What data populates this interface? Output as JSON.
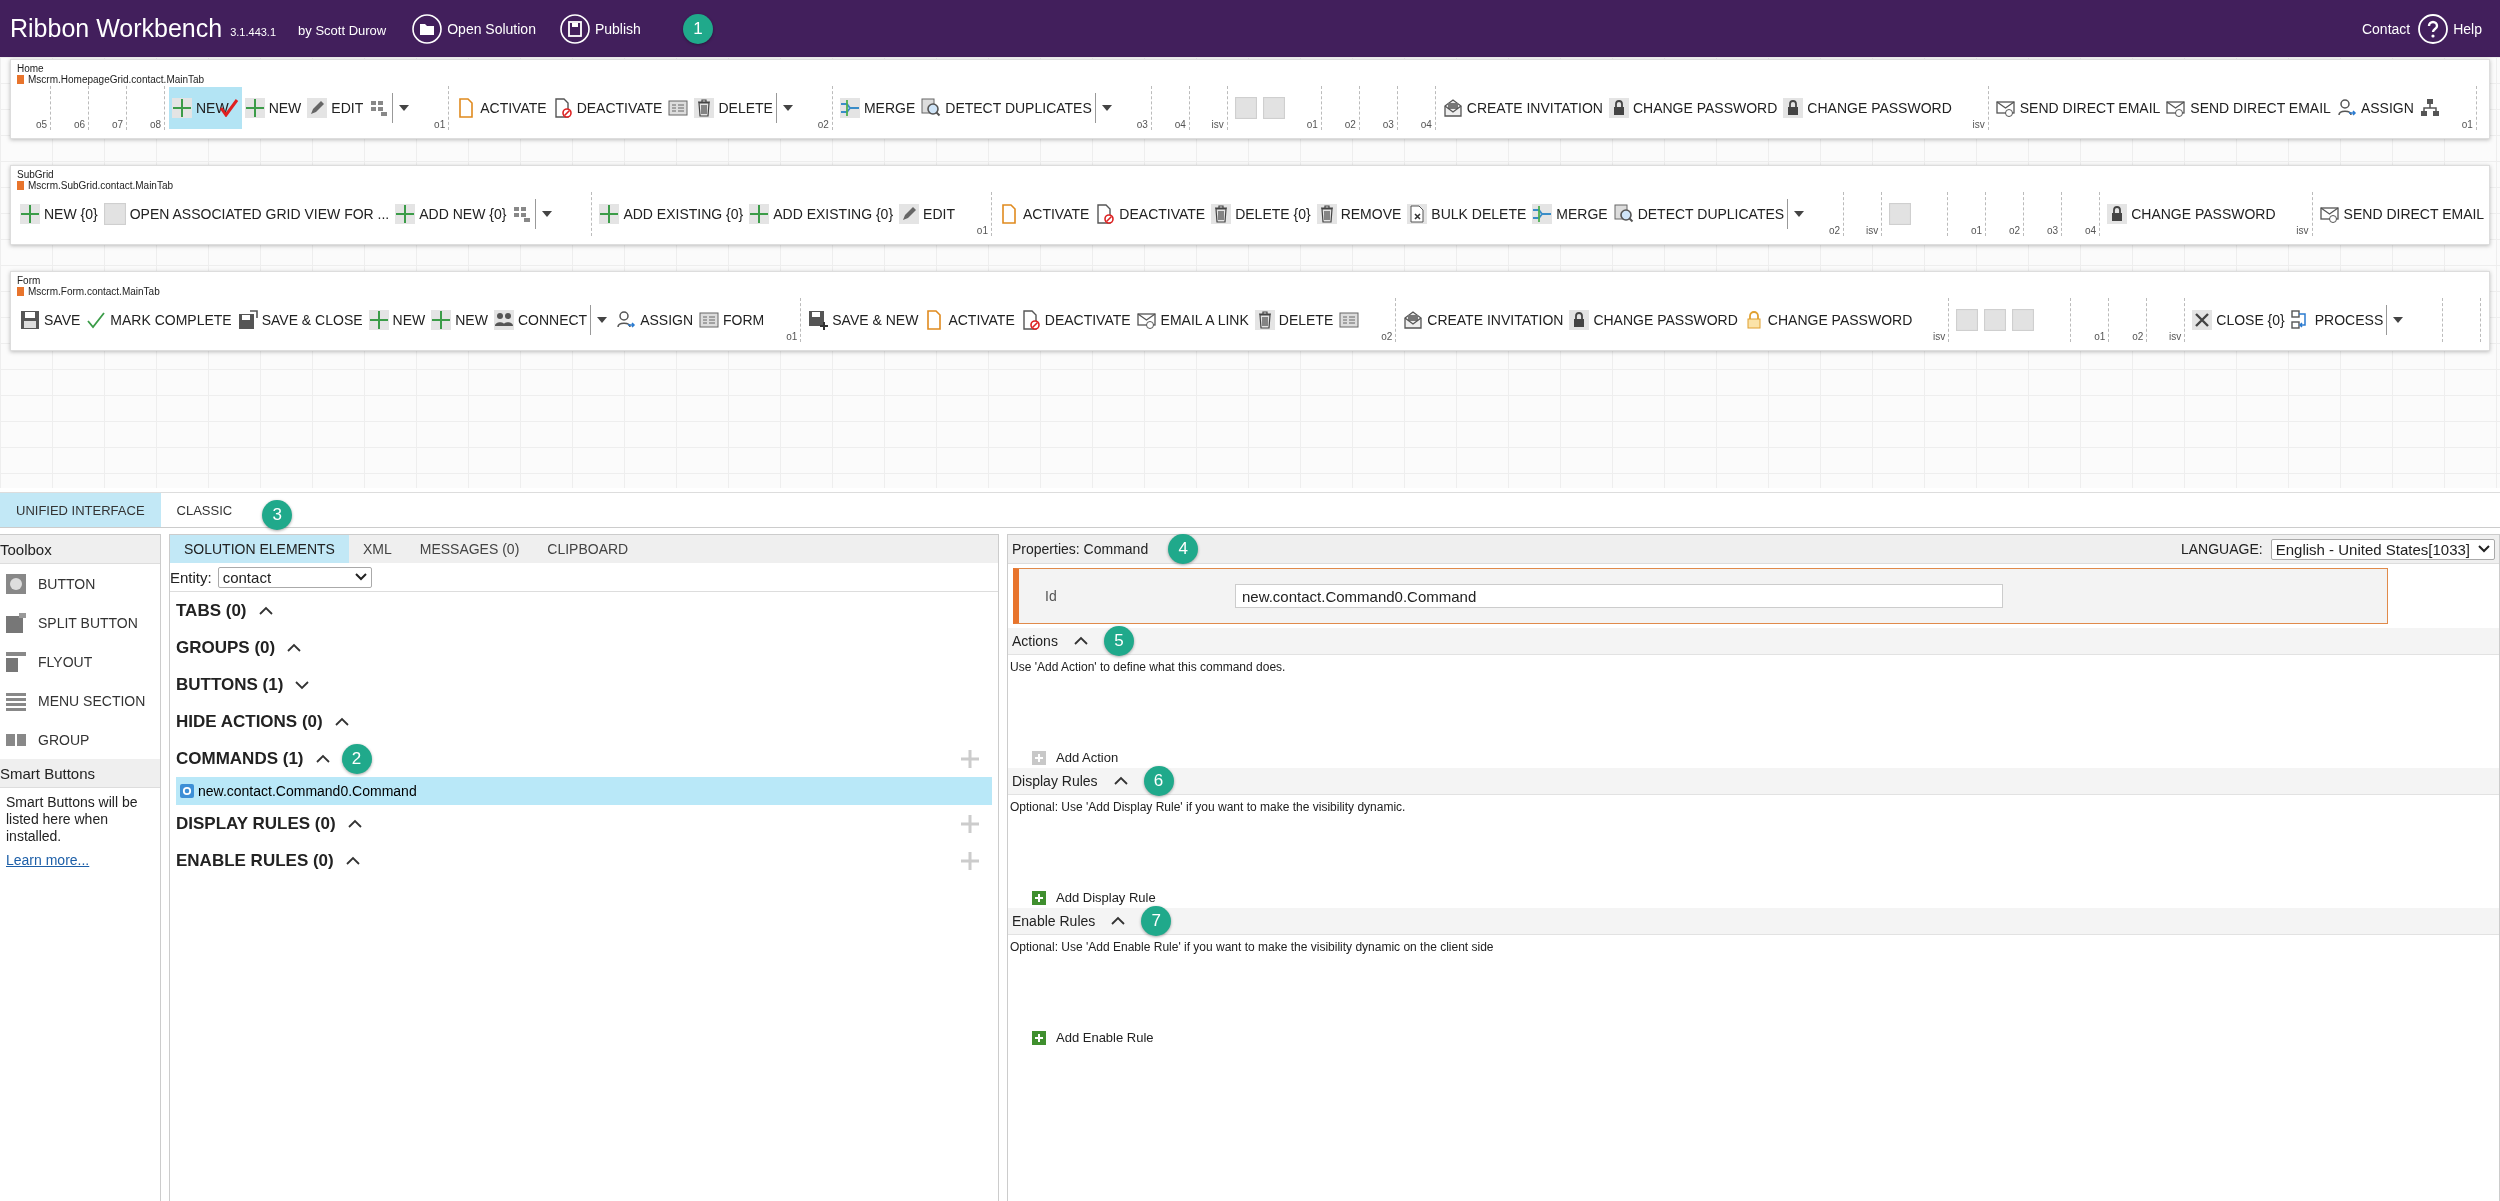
{
  "app": {
    "title": "Ribbon Workbench",
    "version": "3.1.443.1",
    "author": "by Scott Durow",
    "badge": "1"
  },
  "toolbar": [
    {
      "kind": "folder",
      "label": "Open Solution"
    },
    {
      "kind": "save",
      "label": "Publish"
    }
  ],
  "top_links": [
    {
      "kind": "text",
      "label": "Contact"
    },
    {
      "kind": "help",
      "label": "Help"
    }
  ],
  "ribbons": [
    {
      "name": "Home",
      "tab_id": "Mscrm.HomepageGrid.contact.MainTab",
      "items": [
        {
          "kind": "marker",
          "label": "o5"
        },
        {
          "kind": "marker",
          "label": "o6"
        },
        {
          "kind": "marker",
          "label": "o7"
        },
        {
          "kind": "marker",
          "label": "o8"
        },
        {
          "kind": "add",
          "label": "NEW",
          "selected": true
        },
        {
          "kind": "add",
          "label": "NEW",
          "selected": false
        },
        {
          "kind": "edit",
          "label": "EDIT",
          "selected": false
        },
        {
          "kind": "grid",
          "selected": false
        },
        {
          "kind": "dropdown",
          "selected": false
        },
        {
          "kind": "marker",
          "label": "o1"
        },
        {
          "kind": "doc",
          "label": "ACTIVATE",
          "selected": false
        },
        {
          "kind": "docx",
          "label": "DEACTIVATE",
          "selected": false
        },
        {
          "kind": "form",
          "selected": false
        },
        {
          "kind": "trash",
          "label": "DELETE",
          "selected": false
        },
        {
          "kind": "dropdown",
          "selected": false
        },
        {
          "kind": "marker",
          "label": "o2"
        },
        {
          "kind": "merge",
          "label": "MERGE",
          "selected": false
        },
        {
          "kind": "detect",
          "label": "DETECT DUPLICATES",
          "selected": false
        },
        {
          "kind": "dropdown",
          "selected": false
        },
        {
          "kind": "marker",
          "label": "o3"
        },
        {
          "kind": "marker",
          "label": "o4"
        },
        {
          "kind": "marker",
          "label": "isv"
        },
        {
          "kind": "blank",
          "selected": false
        },
        {
          "kind": "blank",
          "selected": false
        },
        {
          "kind": "marker",
          "label": "o1"
        },
        {
          "kind": "marker",
          "label": "o2"
        },
        {
          "kind": "marker",
          "label": "o3"
        },
        {
          "kind": "marker",
          "label": "o4"
        },
        {
          "kind": "invite",
          "label": "CREATE INVITATION",
          "selected": false
        },
        {
          "kind": "lock",
          "label": "CHANGE PASSWORD",
          "selected": false
        },
        {
          "kind": "lock",
          "label": "CHANGE PASSWORD",
          "selected": false
        },
        {
          "kind": "marker",
          "label": "isv"
        },
        {
          "kind": "email",
          "label": "SEND DIRECT EMAIL",
          "selected": false
        },
        {
          "kind": "email",
          "label": "SEND DIRECT EMAIL",
          "selected": false
        },
        {
          "kind": "assign",
          "label": "ASSIGN",
          "selected": false
        },
        {
          "kind": "tree",
          "selected": false
        },
        {
          "kind": "marker",
          "label": "o1"
        }
      ]
    },
    {
      "name": "SubGrid",
      "tab_id": "Mscrm.SubGrid.contact.MainTab",
      "items": [
        {
          "kind": "add",
          "label": "NEW {0}",
          "selected": false
        },
        {
          "kind": "blank",
          "label": "OPEN ASSOCIATED GRID VIEW FOR ...",
          "selected": false
        },
        {
          "kind": "add",
          "label": "ADD NEW {0}",
          "selected": false
        },
        {
          "kind": "grid",
          "selected": false
        },
        {
          "kind": "dropdown",
          "selected": false
        },
        {
          "kind": "marker"
        },
        {
          "kind": "add",
          "label": "ADD EXISTING {0}",
          "selected": false
        },
        {
          "kind": "add",
          "label": "ADD EXISTING {0}",
          "selected": false
        },
        {
          "kind": "edit",
          "label": "EDIT",
          "selected": false
        },
        {
          "kind": "marker",
          "label": "o1"
        },
        {
          "kind": "doc",
          "label": "ACTIVATE",
          "selected": false
        },
        {
          "kind": "docx",
          "label": "DEACTIVATE",
          "selected": false
        },
        {
          "kind": "trash",
          "label": "DELETE {0}",
          "selected": false
        },
        {
          "kind": "trash",
          "label": "REMOVE",
          "selected": false
        },
        {
          "kind": "bulk",
          "label": "BULK DELETE",
          "selected": false
        },
        {
          "kind": "merge",
          "label": "MERGE",
          "selected": false
        },
        {
          "kind": "detect",
          "label": "DETECT DUPLICATES",
          "selected": false
        },
        {
          "kind": "dropdown",
          "selected": false
        },
        {
          "kind": "marker",
          "label": "o2"
        },
        {
          "kind": "marker",
          "label": "isv"
        },
        {
          "kind": "blank",
          "selected": false
        },
        {
          "kind": "marker"
        },
        {
          "kind": "marker",
          "label": "o1"
        },
        {
          "kind": "marker",
          "label": "o2"
        },
        {
          "kind": "marker",
          "label": "o3"
        },
        {
          "kind": "marker",
          "label": "o4"
        },
        {
          "kind": "lock",
          "label": "CHANGE PASSWORD",
          "selected": false
        },
        {
          "kind": "marker",
          "label": "isv"
        },
        {
          "kind": "email",
          "label": "SEND DIRECT EMAIL",
          "selected": false
        }
      ]
    },
    {
      "name": "Form",
      "tab_id": "Mscrm.Form.contact.MainTab",
      "items": [
        {
          "kind": "save",
          "label": "SAVE",
          "selected": false
        },
        {
          "kind": "check",
          "label": "MARK COMPLETE",
          "selected": false
        },
        {
          "kind": "saveclose",
          "label": "SAVE & CLOSE",
          "selected": false
        },
        {
          "kind": "add",
          "label": "NEW",
          "selected": false
        },
        {
          "kind": "add",
          "label": "NEW",
          "selected": false
        },
        {
          "kind": "connect",
          "label": "CONNECT",
          "selected": false
        },
        {
          "kind": "dropdown",
          "selected": false
        },
        {
          "kind": "assign",
          "label": "ASSIGN",
          "selected": false
        },
        {
          "kind": "form",
          "label": "FORM",
          "selected": false
        },
        {
          "kind": "marker",
          "label": "o1"
        },
        {
          "kind": "saveplus",
          "label": "SAVE & NEW",
          "selected": false
        },
        {
          "kind": "doc",
          "label": "ACTIVATE",
          "selected": false
        },
        {
          "kind": "docx",
          "label": "DEACTIVATE",
          "selected": false
        },
        {
          "kind": "email",
          "label": "EMAIL A LINK",
          "selected": false
        },
        {
          "kind": "trash",
          "label": "DELETE",
          "selected": false
        },
        {
          "kind": "form",
          "selected": false
        },
        {
          "kind": "marker",
          "label": "o2"
        },
        {
          "kind": "invite",
          "label": "CREATE INVITATION",
          "selected": false
        },
        {
          "kind": "lock",
          "label": "CHANGE PASSWORD",
          "selected": false
        },
        {
          "kind": "unlock",
          "label": "CHANGE PASSWORD",
          "selected": false
        },
        {
          "kind": "marker",
          "label": "isv"
        },
        {
          "kind": "blank",
          "selected": false
        },
        {
          "kind": "blank",
          "selected": false
        },
        {
          "kind": "blank",
          "selected": false
        },
        {
          "kind": "marker"
        },
        {
          "kind": "marker",
          "label": "o1"
        },
        {
          "kind": "marker",
          "label": "o2"
        },
        {
          "kind": "marker",
          "label": "isv"
        },
        {
          "kind": "close",
          "label": "CLOSE {0}",
          "selected": false
        },
        {
          "kind": "process",
          "label": "PROCESS",
          "selected": false
        },
        {
          "kind": "dropdown",
          "selected": false
        },
        {
          "kind": "marker"
        },
        {
          "kind": "marker"
        }
      ]
    }
  ],
  "view_tabs": [
    {
      "label": "UNIFIED INTERFACE",
      "selected": true
    },
    {
      "label": "CLASSIC",
      "selected": false
    }
  ],
  "view_badge": "3",
  "toolbox": {
    "title": "Toolbox",
    "items": [
      {
        "kind": "button",
        "label": "BUTTON"
      },
      {
        "kind": "split",
        "label": "SPLIT BUTTON"
      },
      {
        "kind": "flyout",
        "label": "FLYOUT"
      },
      {
        "kind": "menu",
        "label": "MENU SECTION"
      },
      {
        "kind": "group",
        "label": "GROUP"
      }
    ],
    "smart_title": "Smart Buttons",
    "smart_text": "Smart Buttons will be listed here when installed.",
    "learn_more": "Learn more..."
  },
  "solution": {
    "tabs": [
      {
        "label": "SOLUTION ELEMENTS",
        "selected": true
      },
      {
        "label": "XML",
        "selected": false
      },
      {
        "label": "MESSAGES (0)",
        "selected": false
      },
      {
        "label": "CLIPBOARD",
        "selected": false
      }
    ],
    "entity_label": "Entity:",
    "entity_value": "contact",
    "sections": [
      {
        "label": "TABS (0)",
        "expanded": true,
        "add_button": false
      },
      {
        "label": "GROUPS (0)",
        "expanded": true,
        "add_button": false
      },
      {
        "label": "BUTTONS (1)",
        "expanded": false,
        "add_button": false
      },
      {
        "label": "HIDE ACTIONS (0)",
        "expanded": true,
        "add_button": false
      },
      {
        "label": "COMMANDS (1)",
        "expanded": true,
        "add_button": true,
        "badge": "2",
        "children": [
          {
            "label": "new.contact.Command0.Command",
            "selected": true
          }
        ]
      },
      {
        "label": "DISPLAY RULES (0)",
        "expanded": true,
        "add_button": true
      },
      {
        "label": "ENABLE RULES (0)",
        "expanded": true,
        "add_button": true
      }
    ]
  },
  "properties": {
    "title": "Properties: Command",
    "badge": "4",
    "language_label": "LANGUAGE:",
    "language_value": "English - United States[1033]",
    "id_label": "Id",
    "id_value": "new.contact.Command0.Command",
    "sections": [
      {
        "title": "Actions",
        "badge": "5",
        "hint": "Use 'Add Action' to define what this command does.",
        "add_label": "Add Action",
        "add_enabled": false
      },
      {
        "title": "Display Rules",
        "badge": "6",
        "hint": "Optional: Use 'Add Display Rule' if you want to make the visibility dynamic.",
        "add_label": "Add Display Rule",
        "add_enabled": true
      },
      {
        "title": "Enable Rules",
        "badge": "7",
        "hint": "Optional: Use 'Add Enable Rule' if you want to make the visibility dynamic on the client side",
        "add_label": "Add Enable Rule",
        "add_enabled": true
      }
    ]
  }
}
